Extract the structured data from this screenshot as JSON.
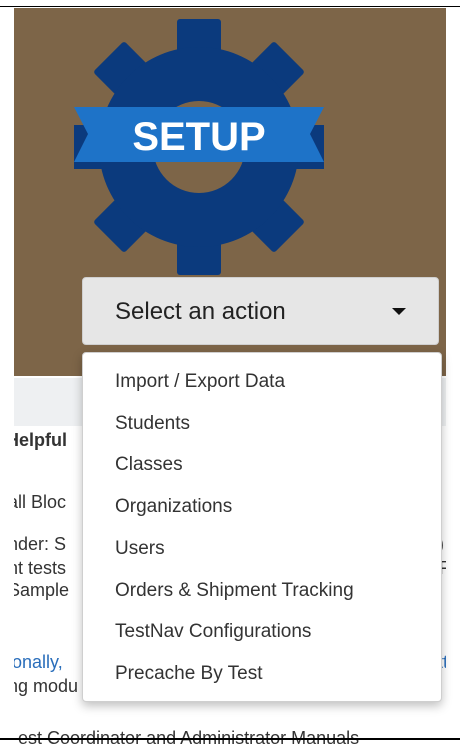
{
  "hero": {
    "title": "SETUP",
    "background_color": "#7d6548",
    "gear_color": "#0b3a7d",
    "banner_color": "#1e73c8"
  },
  "select": {
    "label": "Select an action"
  },
  "menu": {
    "items": [
      {
        "label": "Import / Export Data"
      },
      {
        "label": "Students"
      },
      {
        "label": "Classes"
      },
      {
        "label": "Organizations"
      },
      {
        "label": "Users"
      },
      {
        "label": "Orders & Shipment Tracking"
      },
      {
        "label": "TestNav Configurations"
      },
      {
        "label": "Precache By Test"
      }
    ]
  },
  "content": {
    "heading": "Helpful",
    "lines_left": [
      "all Bloc",
      "nder: S",
      "nt tests",
      "Sample",
      "ionally,",
      "ng modu"
    ],
    "lines_right": [
      "n",
      "P)",
      "NF",
      "ntt"
    ],
    "last_line": "est Coordinator and Administrator Manuals"
  }
}
